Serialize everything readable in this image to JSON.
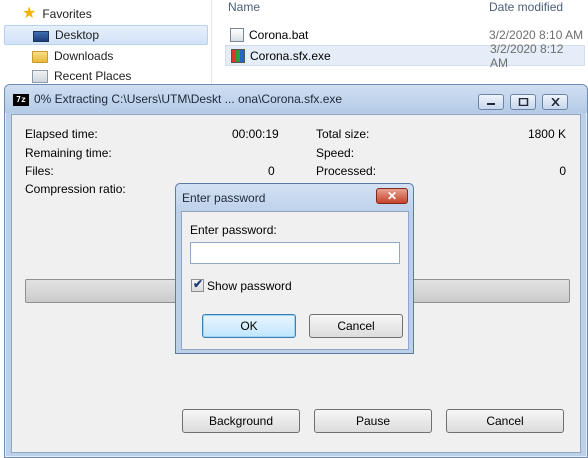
{
  "explorer": {
    "nav": [
      {
        "label": "Favorites",
        "icon": "star-icon"
      },
      {
        "label": "Desktop",
        "icon": "desktop-icon",
        "selected": true
      },
      {
        "label": "Downloads",
        "icon": "downloads-folder-icon"
      },
      {
        "label": "Recent Places",
        "icon": "recent-places-icon"
      }
    ],
    "columns": {
      "name": "Name",
      "date": "Date modified"
    },
    "files": [
      {
        "name": "Corona.bat",
        "date": "3/2/2020 8:10 AM",
        "icon": "batch-file-icon"
      },
      {
        "name": "Corona.sfx.exe",
        "date": "3/2/2020 8:12 AM",
        "icon": "exe-file-icon",
        "selected": true
      }
    ]
  },
  "progress": {
    "icon_text": "7z",
    "title": "0% Extracting C:\\Users\\UTM\\Deskt ... ona\\Corona.sfx.exe",
    "percent": 0,
    "left_stats": {
      "elapsed_label": "Elapsed time:",
      "elapsed_value": "00:00:19",
      "remaining_label": "Remaining time:",
      "files_label": "Files:",
      "files_value": "0",
      "ratio_label": "Compression ratio:"
    },
    "right_stats": {
      "total_label": "Total size:",
      "total_value": "1800 K",
      "speed_label": "Speed:",
      "processed_label": "Processed:",
      "processed_value": "0"
    },
    "buttons": {
      "background": "Background",
      "pause": "Pause",
      "cancel": "Cancel"
    }
  },
  "password_dialog": {
    "title": "Enter password",
    "label": "Enter password:",
    "input_value": "",
    "show_password_label": "Show password",
    "show_password_checked": true,
    "ok": "OK",
    "cancel": "Cancel"
  },
  "colors": {
    "window_frame": "#bcd0e8",
    "close_button": "#c6432c",
    "ok_button_border": "#3c7fb1"
  }
}
